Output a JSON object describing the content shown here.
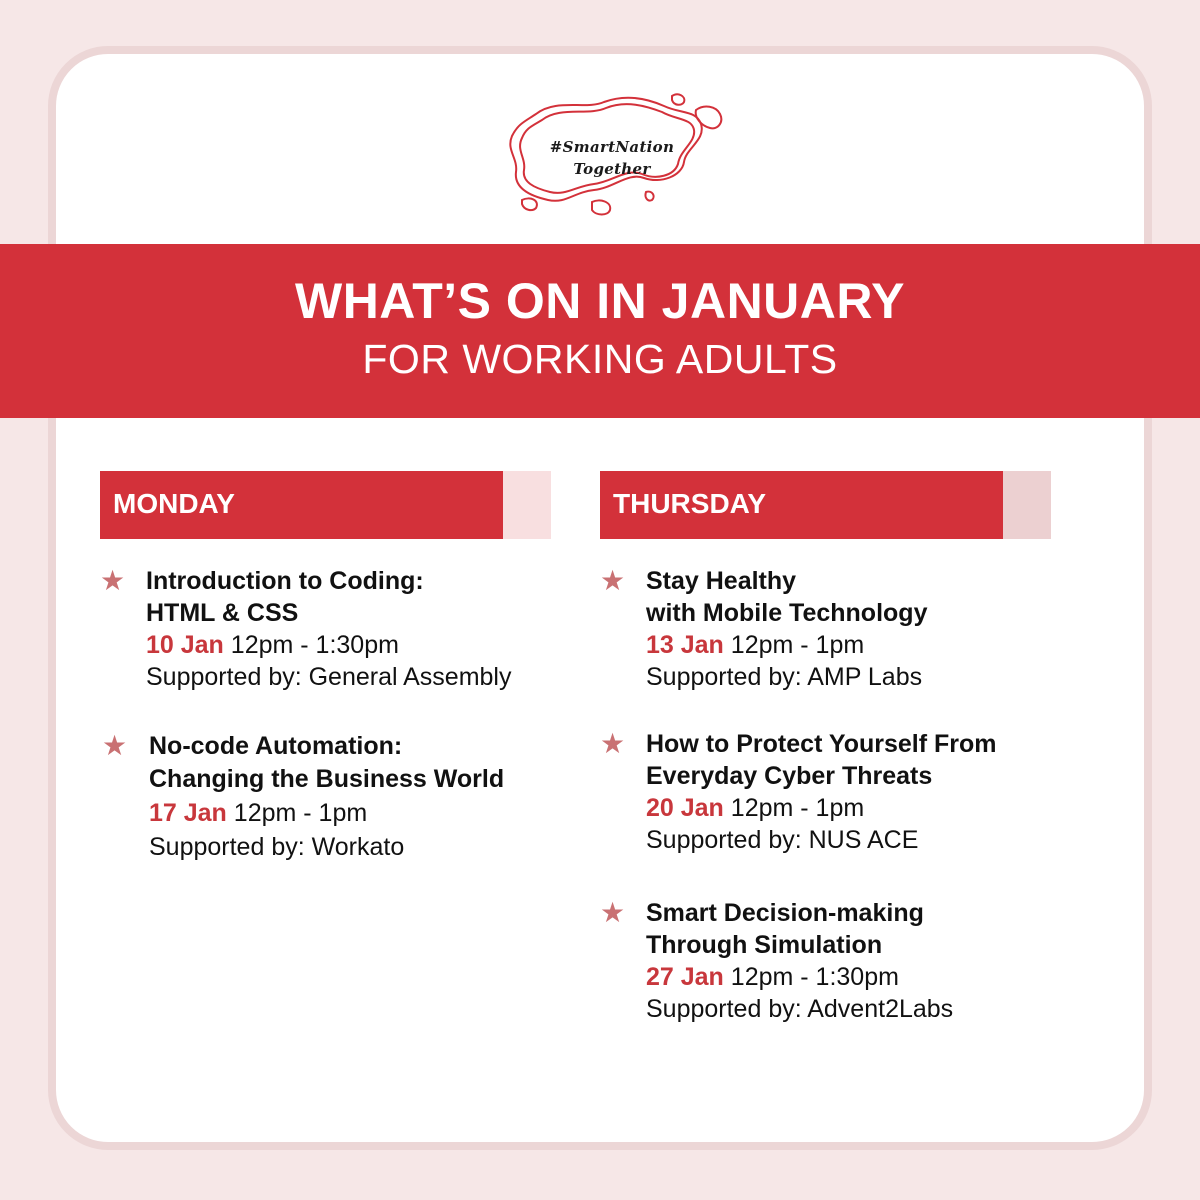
{
  "logo": {
    "line1": "#SmartNation",
    "line2": "Together"
  },
  "banner": {
    "title": "WHAT’S ON IN JANUARY",
    "subtitle": "FOR WORKING ADULTS"
  },
  "colors": {
    "accent": "#d3313a",
    "tab_monday": "#f8dfe0",
    "tab_thursday": "#ecd0d1",
    "star": "#c97173"
  },
  "monday": {
    "label": "MONDAY",
    "events": [
      {
        "title1": "Introduction to Coding:",
        "title2": "HTML & CSS",
        "date": "10 Jan",
        "time": " 12pm - 1:30pm",
        "support": "Supported by: General Assembly"
      },
      {
        "title1": "No-code Automation:",
        "title2": "Changing the Business World",
        "date": "17 Jan",
        "time": " 12pm - 1pm",
        "support": "Supported by: Workato"
      }
    ]
  },
  "thursday": {
    "label": "THURSDAY",
    "events": [
      {
        "title1": "Stay Healthy",
        "title2": "with Mobile Technology",
        "date": "13 Jan",
        "time": " 12pm - 1pm",
        "support": "Supported by: AMP Labs"
      },
      {
        "title1": "How to Protect Yourself From",
        "title2": "Everyday Cyber Threats",
        "date": "20 Jan",
        "time": " 12pm - 1pm",
        "support": "Supported by: NUS ACE"
      },
      {
        "title1": "Smart Decision-making",
        "title2": "Through Simulation",
        "date": "27 Jan",
        "time": " 12pm - 1:30pm",
        "support": "Supported by: Advent2Labs"
      }
    ]
  }
}
